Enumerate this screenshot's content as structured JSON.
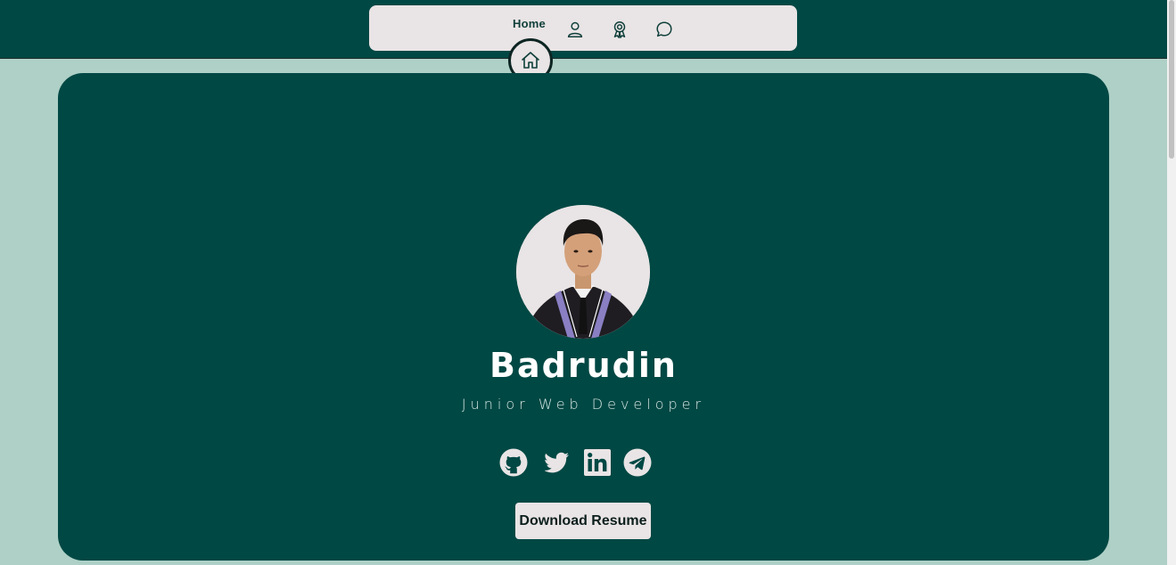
{
  "nav": {
    "items": [
      {
        "label": "Home",
        "icon": "home-icon",
        "active": true
      },
      {
        "label": "",
        "icon": "user-icon"
      },
      {
        "label": "",
        "icon": "award-icon"
      },
      {
        "label": "",
        "icon": "chat-icon"
      }
    ]
  },
  "profile": {
    "name": "Badrudin",
    "role": "Junior Web Developer",
    "avatar": "profile-photo"
  },
  "social": [
    {
      "name": "GitHub",
      "icon": "github-icon"
    },
    {
      "name": "Twitter",
      "icon": "twitter-icon"
    },
    {
      "name": "LinkedIn",
      "icon": "linkedin-icon"
    },
    {
      "name": "Telegram",
      "icon": "telegram-icon"
    }
  ],
  "actions": {
    "download_label": "Download Resume"
  },
  "colors": {
    "page_bg": "#aed0c6",
    "primary": "#004844",
    "light": "#e9e4e5",
    "text_light": "#ffffff"
  }
}
